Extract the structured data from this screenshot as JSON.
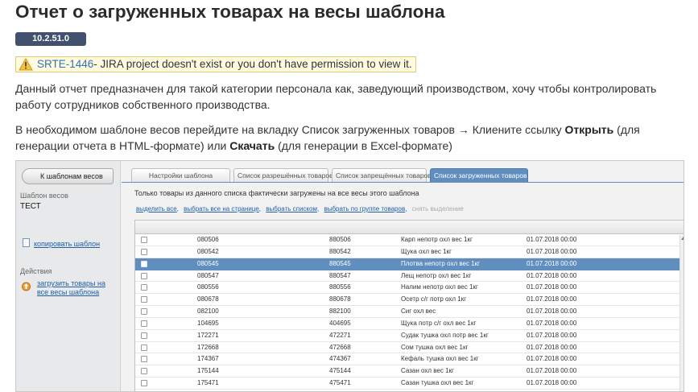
{
  "page": {
    "title": "Отчет о загруженных товарах на весы шаблона",
    "version": "10.2.51.0",
    "jira": {
      "key": "SRTE-1446",
      "message": " - JIRA project doesn't exist or you don't have permission to view it."
    },
    "para1_line1": "Данный отчет предназначен для такой категории персонала как, заведующий производством, хочу чтобы контролировать",
    "para1_line2": "работу сотрудников собственного производства.",
    "para2_line1_a": "В необходимом шаблоне весов перейдите на вкладку Список загруженных товаров → Клиените ссылку ",
    "para2_line1_b": "Открыть",
    "para2_line1_c": " (для",
    "para2_line2_a": "генерации отчета в HTML-формате) или ",
    "para2_line2_b": "Скачать",
    "para2_line2_c": " (для генерации в Excel-формате)"
  },
  "app": {
    "back_button": "К шаблонам весов",
    "template_label": "Шаблон весов",
    "template_value": "ТЕСТ",
    "copy_link": "копировать шаблон",
    "actions_label": "Действия",
    "upload_link_1": "загрузить товары на",
    "upload_link_2": "все весы шаблона",
    "tabs": [
      {
        "label": "Настройки шаблона"
      },
      {
        "label": "Список разрешённых товаров"
      },
      {
        "label": "Список запрещённых товаров"
      },
      {
        "label": "Список загруженных товаров"
      }
    ],
    "active_tab": 3,
    "info_text": "Только товары из данного списка фактически загружены на все весы этого шаблона",
    "actions": {
      "select_all": "выделить все",
      "select_page": "выбрать все на странице",
      "select_list": "выбрать списком",
      "select_group": "выбрать по группе товаров",
      "clear": "снять выделение"
    },
    "rows": [
      {
        "code": "080506",
        "plu": "880506",
        "name": "Карп непотр охл вес 1кг",
        "date": "01.07.2018 00:00"
      },
      {
        "code": "080542",
        "plu": "880542",
        "name": "Щука охл вес 1кг",
        "date": "01.07.2018 00:00"
      },
      {
        "code": "080545",
        "plu": "880545",
        "name": "Плотва непотр охл вес 1кг",
        "date": "01.07.2018 00:00"
      },
      {
        "code": "080547",
        "plu": "880547",
        "name": "Лещ непотр охл вес 1кг",
        "date": "01.07.2018 00:00"
      },
      {
        "code": "080556",
        "plu": "880556",
        "name": "Налим непотр охл вес 1кг",
        "date": "01.07.2018 00:00"
      },
      {
        "code": "080678",
        "plu": "880678",
        "name": "Осетр с/г потр охл 1кг",
        "date": "01.07.2018 00:00"
      },
      {
        "code": "082100",
        "plu": "882100",
        "name": "Сиг охл вес",
        "date": "01.07.2018 00:00"
      },
      {
        "code": "104695",
        "plu": "404695",
        "name": "Щука потр с/г охл вес 1кг",
        "date": "01.07.2018 00:00"
      },
      {
        "code": "172271",
        "plu": "472271",
        "name": "Судак тушка охл потр вес 1кг",
        "date": "01.07.2018 00:00"
      },
      {
        "code": "172668",
        "plu": "472668",
        "name": "Сом тушка охл вес 1кг",
        "date": "01.07.2018 00:00"
      },
      {
        "code": "174367",
        "plu": "474367",
        "name": "Кефаль тушка охл вес 1кг",
        "date": "01.07.2018 00:00"
      },
      {
        "code": "175144",
        "plu": "475144",
        "name": "Сазан охл вес 1кг",
        "date": "01.07.2018 00:00"
      },
      {
        "code": "175471",
        "plu": "475471",
        "name": "Сазан тушка охл вес 1кг",
        "date": "01.07.2018 00:00"
      }
    ],
    "selected_row": 2,
    "colors": {
      "accent": "#5f8ebf",
      "badge": "#42526e",
      "link": "#2260a8"
    }
  }
}
